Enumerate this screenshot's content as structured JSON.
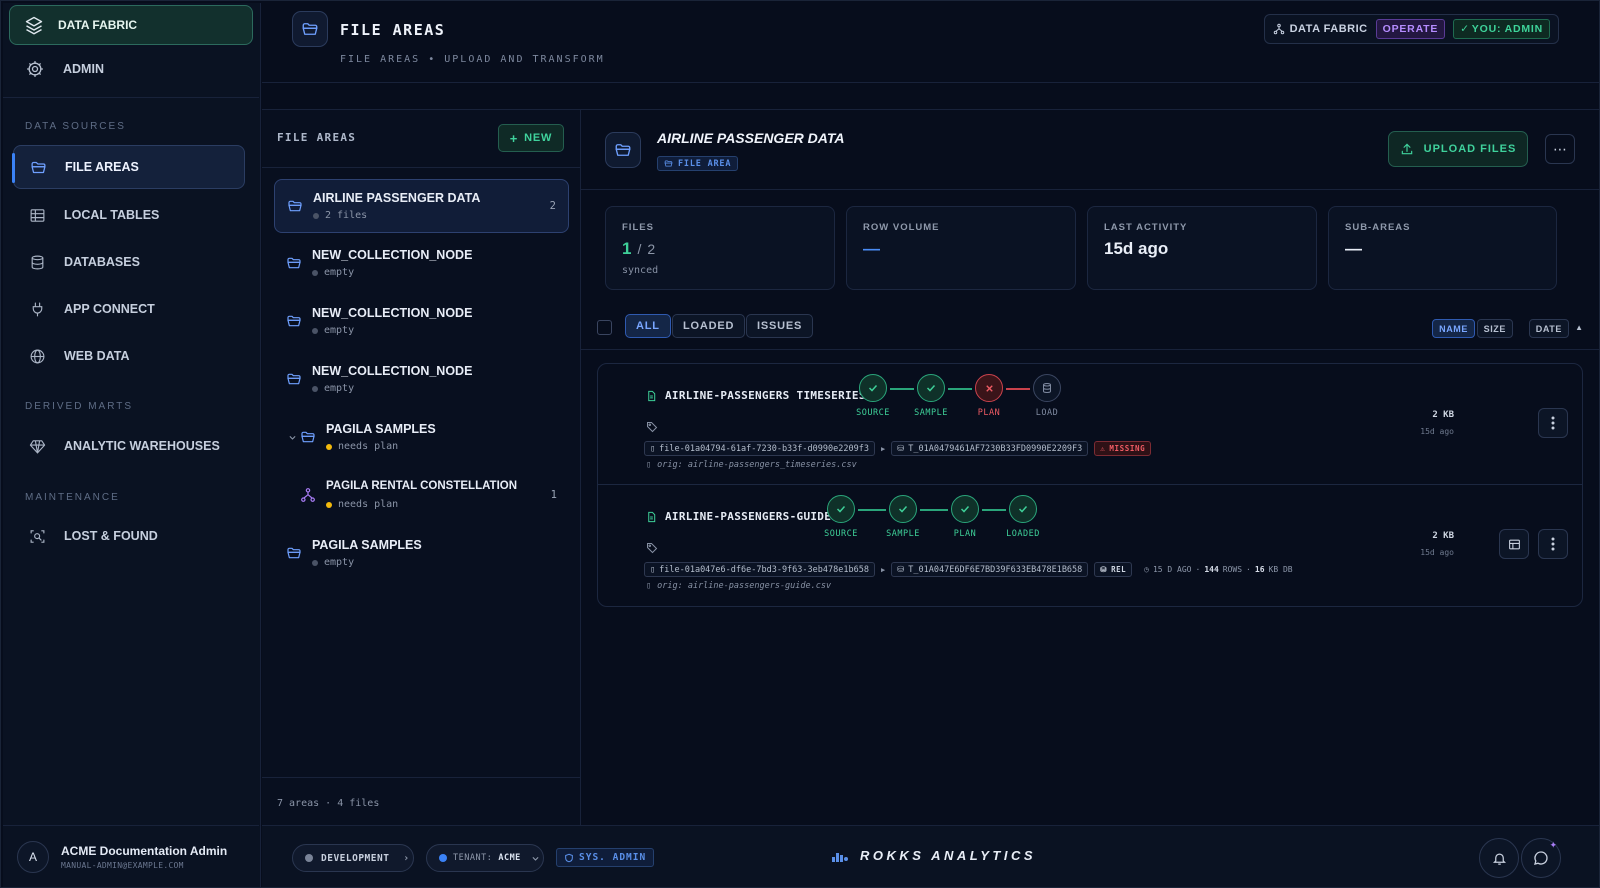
{
  "sidebar": {
    "app_label": "DATA FABRIC",
    "admin_label": "ADMIN",
    "sections": {
      "data_sources": "DATA SOURCES",
      "derived_marts": "DERIVED MARTS",
      "maintenance": "MAINTENANCE"
    },
    "items": {
      "file_areas": "FILE AREAS",
      "local_tables": "LOCAL TABLES",
      "databases": "DATABASES",
      "app_connect": "APP CONNECT",
      "web_data": "WEB DATA",
      "analytic_warehouses": "ANALYTIC WAREHOUSES",
      "lost_found": "LOST & FOUND"
    },
    "user": {
      "initial": "A",
      "name": "ACME Documentation Admin",
      "email": "MANUAL-ADMIN@EXAMPLE.COM"
    }
  },
  "header": {
    "title": "FILE AREAS",
    "subtitle": "FILE AREAS • UPLOAD AND TRANSFORM",
    "badge_fabric": "DATA FABRIC",
    "badge_mode": "OPERATE",
    "badge_you": "YOU: ADMIN"
  },
  "list": {
    "title": "FILE AREAS",
    "new_label": "NEW",
    "items": [
      {
        "name": "AIRLINE PASSENGER DATA",
        "status": "2 files",
        "count": "2"
      },
      {
        "name": "NEW_COLLECTION_NODE",
        "status": "empty",
        "count": ""
      },
      {
        "name": "NEW_COLLECTION_NODE",
        "status": "empty",
        "count": ""
      },
      {
        "name": "NEW_COLLECTION_NODE",
        "status": "empty",
        "count": ""
      },
      {
        "name": "PAGILA SAMPLES",
        "status": "needs plan",
        "count": ""
      },
      {
        "name": "PAGILA RENTAL CONSTELLATION",
        "status": "needs plan",
        "count": "1"
      },
      {
        "name": "PAGILA SAMPLES",
        "status": "empty",
        "count": ""
      }
    ],
    "footer": "7 areas · 4 files"
  },
  "main": {
    "title": "AIRLINE PASSENGER DATA",
    "tag": "FILE AREA",
    "upload_label": "UPLOAD FILES",
    "stats": {
      "files_label": "FILES",
      "files_done": "1",
      "files_sep": "/",
      "files_total": "2",
      "files_sub": "synced",
      "rows_label": "ROW VOLUME",
      "rows_value": "—",
      "activity_label": "LAST ACTIVITY",
      "activity_value": "15d ago",
      "sub_label": "SUB-AREAS",
      "sub_value": "—"
    },
    "filters": {
      "all": "ALL",
      "loaded": "LOADED",
      "issues": "ISSUES"
    },
    "sort": {
      "name": "NAME",
      "size": "SIZE",
      "date": "DATE",
      "arrow": "▲"
    },
    "files": [
      {
        "name": "AIRLINE-PASSENGERS TIMESERIES",
        "steps": [
          "SOURCE",
          "SAMPLE",
          "PLAN",
          "LOAD"
        ],
        "file_id": "file-01a04794-61af-7230-b33f-d0990e2209f3",
        "table_id": "T_01A0479461AF7230B33FD0990E2209F3",
        "status_chip": "MISSING",
        "orig": "orig: airline-passengers_timeseries.csv",
        "size": "2 KB",
        "date": "15d ago"
      },
      {
        "name": "AIRLINE-PASSENGERS-GUIDE",
        "steps": [
          "SOURCE",
          "SAMPLE",
          "PLAN",
          "LOADED"
        ],
        "file_id": "file-01a047e6-df6e-7bd3-9f63-3eb478e1b658",
        "table_id": "T_01A047E6DF6E7BD39F633EB478E1B658",
        "status_chip": "REL",
        "meta_age": "15 D AGO",
        "meta_rows_n": "144",
        "meta_rows_l": "ROWS",
        "meta_db_n": "16",
        "meta_db_l": "KB DB",
        "orig": "orig: airline-passengers-guide.csv",
        "size": "2 KB",
        "date": "15d ago"
      }
    ]
  },
  "bottom": {
    "env": "DEVELOPMENT",
    "tenant_label": "TENANT:",
    "tenant_value": "ACME",
    "sys": "SYS. ADMIN",
    "brand": "ROKKS ANALYTICS"
  },
  "colors": {
    "accent_green": "#3ecf98",
    "accent_blue": "#3b82f6",
    "error": "#ef5b64",
    "warn": "#f2b90c"
  }
}
